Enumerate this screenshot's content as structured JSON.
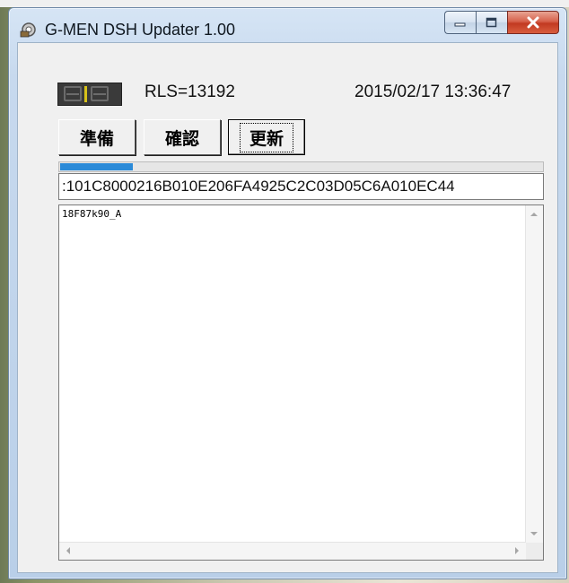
{
  "window": {
    "title": "G-MEN DSH Updater 1.00",
    "icon": "app-gear-icon",
    "controls": {
      "minimize": "minimize-icon",
      "maximize": "maximize-icon",
      "close": "close-icon"
    }
  },
  "status": {
    "rls_label": "RLS=13192",
    "datetime": "2015/02/17 13:36:47",
    "indicator_icon": "led-indicator-icon"
  },
  "buttons": {
    "prepare": "準備",
    "confirm": "確認",
    "update": "更新"
  },
  "progress": {
    "fraction": 0.15,
    "color": "#2b8ad8"
  },
  "hex_line": ":101C8000216B010E206FA4925C2C03D05C6A010EC44",
  "log": {
    "lines": [
      "18F87k90_A"
    ]
  }
}
